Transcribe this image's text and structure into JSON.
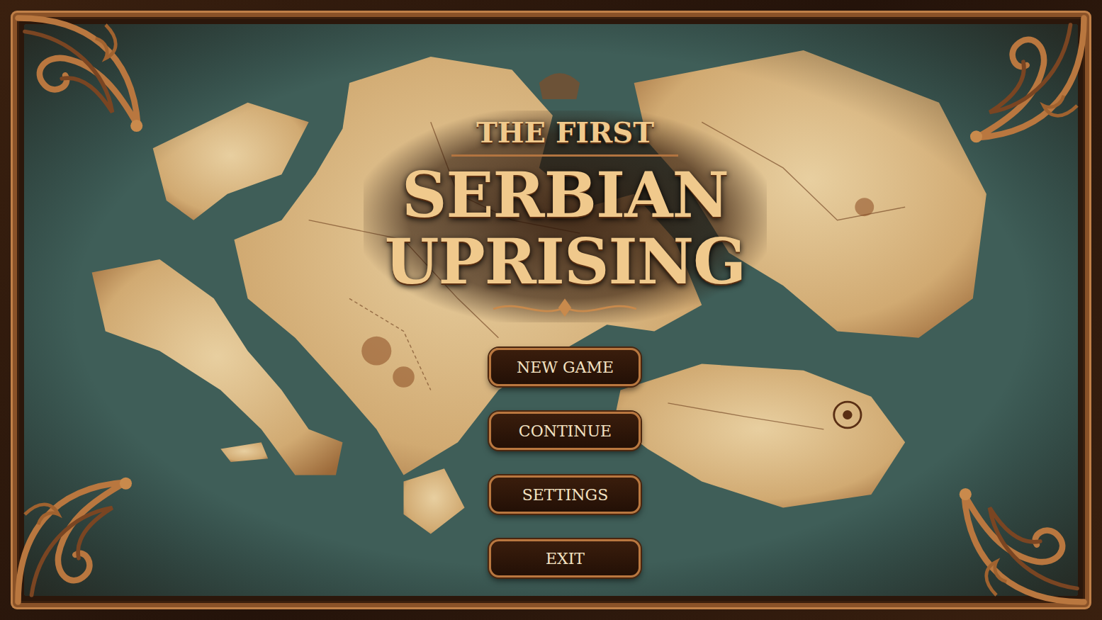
{
  "title": {
    "kicker": "THE FIRST",
    "line1": "SERBIAN",
    "line2": "UPRISING"
  },
  "menu": [
    {
      "label": "NEW GAME"
    },
    {
      "label": "CONTINUE"
    },
    {
      "label": "SETTINGS"
    },
    {
      "label": "EXIT"
    }
  ]
}
